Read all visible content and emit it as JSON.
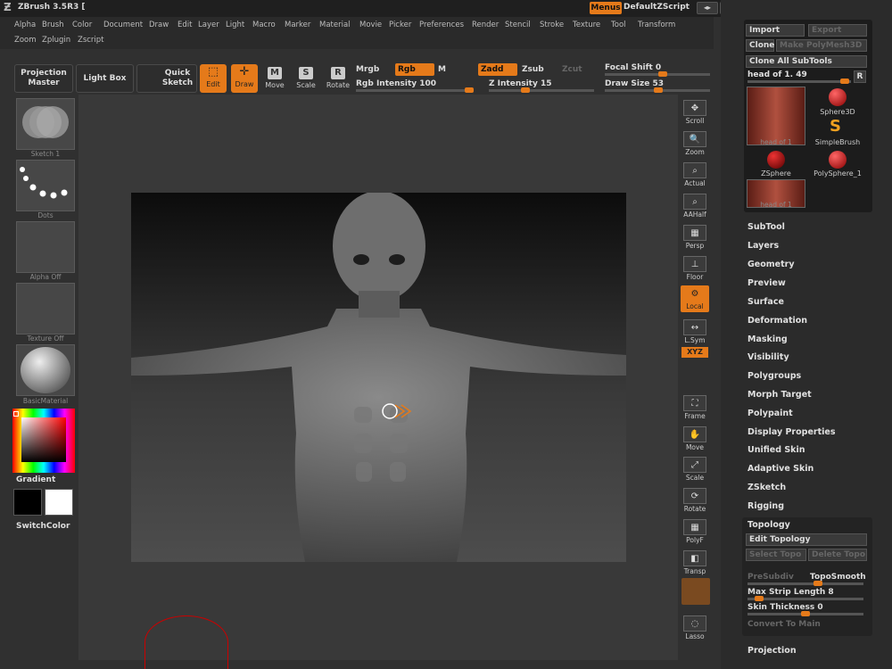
{
  "app": {
    "title": "ZBrush 3.5R3 [",
    "menus_label": "Menus",
    "script_label": "DefaultZScript"
  },
  "menubar": {
    "row1": [
      "Alpha",
      "Brush",
      "Color",
      "Document",
      "Draw",
      "Edit",
      "Layer",
      "Light",
      "Macro",
      "Marker",
      "Material",
      "Movie",
      "Picker",
      "Preferences",
      "Render",
      "Stencil",
      "Stroke",
      "Texture",
      "Tool",
      "Transform"
    ],
    "row2": [
      "Zoom",
      "Zplugin",
      "Zscript"
    ]
  },
  "toolbar": {
    "projection_master": "Projection Master",
    "light_box": "Light Box",
    "quick_sketch": "Quick Sketch",
    "edit": "Edit",
    "draw": "Draw",
    "move": "Move",
    "scale": "Scale",
    "rotate": "Rotate",
    "mrgb": "Mrgb",
    "rgb": "Rgb",
    "m": "M",
    "zadd": "Zadd",
    "zsub": "Zsub",
    "zcut": "Zcut",
    "rgb_intensity": "Rgb Intensity 100",
    "z_intensity": "Z Intensity 15",
    "focal_shift": "Focal Shift 0",
    "draw_size": "Draw Size 53"
  },
  "left_shelf": {
    "brush": "Sketch 1",
    "stroke": "Dots",
    "alpha": "Alpha Off",
    "texture": "Texture Off",
    "material": "BasicMaterial",
    "gradient": "Gradient",
    "switch_color": "SwitchColor"
  },
  "right_shelf": [
    "Scroll",
    "Zoom",
    "Actual",
    "AAHalf",
    "Persp",
    "Floor",
    "Local",
    "L.Sym",
    "XYZ",
    "Frame",
    "Move",
    "Scale",
    "Rotate",
    "PolyF",
    "Transp",
    "Lasso"
  ],
  "tool_panel": {
    "import": "Import",
    "export": "Export",
    "clone": "Clone",
    "make_polymesh": "Make PolyMesh3D",
    "clone_all": "Clone All SubTools",
    "current_tool": "head of 1. 49",
    "r": "R",
    "tools": [
      "head of 1",
      "Sphere3D",
      "SimpleBrush",
      "ZSphere",
      "PolySphere_1",
      "head of 1"
    ]
  },
  "sidebar": {
    "items": [
      "SubTool",
      "Layers",
      "Geometry",
      "Preview",
      "Surface",
      "Deformation",
      "Masking",
      "Visibility",
      "Polygroups",
      "Morph Target",
      "Polypaint",
      "Display Properties",
      "Unified Skin",
      "Adaptive Skin",
      "ZSketch",
      "Rigging"
    ],
    "topology": "Topology",
    "edit_topology": "Edit Topology",
    "select_topo": "Select Topo",
    "delete_topo": "Delete Topo",
    "presubdiv": "PreSubdiv",
    "toposmooth": "TopoSmooth",
    "max_strip": "Max Strip Length 8",
    "skin_thickness": "Skin Thickness 0",
    "convert": "Convert To Main",
    "projection": "Projection"
  },
  "colors": {
    "accent": "#e57a1a"
  }
}
